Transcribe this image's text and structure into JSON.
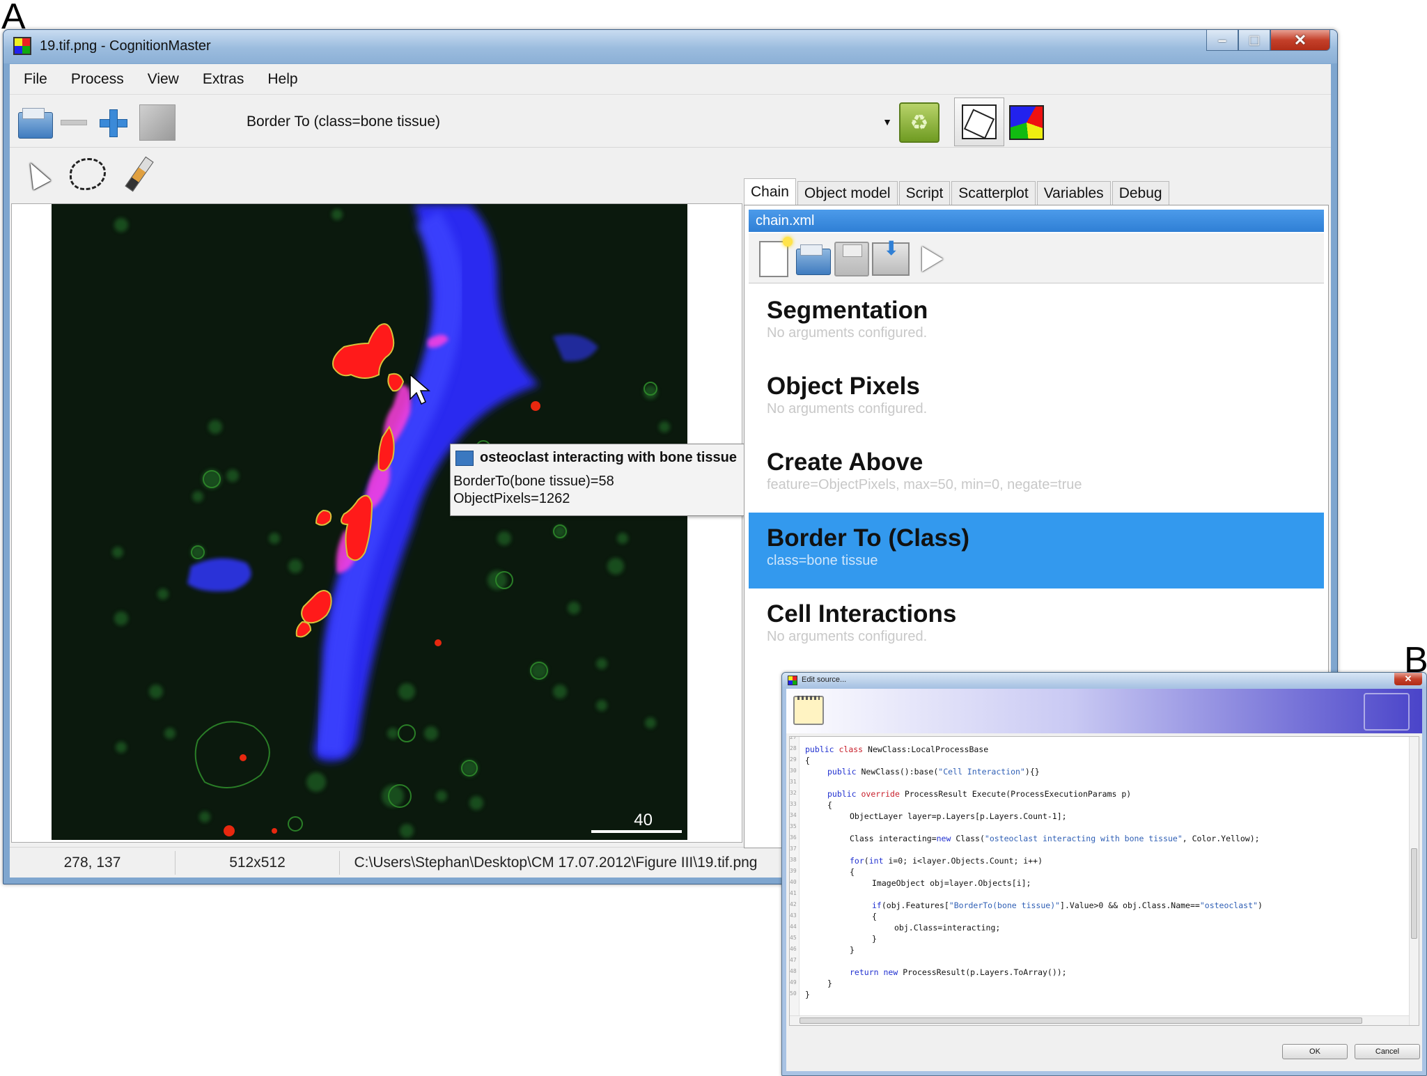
{
  "labels": {
    "panel_a": "A",
    "panel_b": "B"
  },
  "window_a": {
    "title": "19.tif.png - CognitionMaster",
    "menu": [
      "File",
      "Process",
      "View",
      "Extras",
      "Help"
    ],
    "toolbar": {
      "process_combo_value": "Border To (class=bone tissue)",
      "icons": [
        "open-folder-icon",
        "zoom-out-icon",
        "zoom-in-icon",
        "fit-to-window-icon",
        "recycle-bin-icon",
        "segment-outline-icon",
        "segment-colors-icon"
      ]
    },
    "tools": [
      "pointer-icon",
      "lasso-icon",
      "brush-icon"
    ],
    "image": {
      "scale_bar_label": "40",
      "tooltip": {
        "title": "osteoclast interacting with bone tissue",
        "line1": "BorderTo(bone tissue)=58",
        "line2": "ObjectPixels=1262"
      }
    },
    "status": {
      "coordinates": "278, 137",
      "dimensions": "512x512",
      "path": "C:\\Users\\Stephan\\Desktop\\CM 17.07.2012\\Figure III\\19.tif.png"
    },
    "tabs": [
      "Chain",
      "Object model",
      "Script",
      "Scatterplot",
      "Variables",
      "Debug"
    ],
    "active_tab": "Chain",
    "chain": {
      "file": "chain.xml",
      "steps": [
        {
          "name": "Segmentation",
          "args": "No arguments configured."
        },
        {
          "name": "Object Pixels",
          "args": "No arguments configured."
        },
        {
          "name": "Create Above",
          "args": "feature=ObjectPixels, max=50, min=0, negate=true"
        },
        {
          "name": "Border To (Class)",
          "args": "class=bone tissue"
        },
        {
          "name": "Cell Interactions",
          "args": "No arguments configured."
        }
      ],
      "selected_step": "Border To (Class)"
    },
    "colors": {
      "accent": "#3399ee",
      "title_bar": "#9bbcde"
    }
  },
  "window_b": {
    "title": "Edit source...",
    "line_numbers": [
      "27",
      "28",
      "29",
      "30",
      "31",
      "32",
      "33",
      "34",
      "35",
      "36",
      "37",
      "38",
      "39",
      "40",
      "41",
      "42",
      "43",
      "44",
      "45",
      "46",
      "47",
      "48",
      "49",
      "50"
    ],
    "code": {
      "l1_kw1": "public",
      "l1_kw2": "class",
      "l1_rest": "NewClass:LocalProcessBase",
      "l2": "{",
      "l3_kw": "public",
      "l3_rest": "NewClass():base(",
      "l3_str": "\"Cell Interaction\"",
      "l3_end": "){}",
      "l4_kw1": "public",
      "l4_kw2": "override",
      "l4_rest": "ProcessResult Execute(ProcessExecutionParams p)",
      "l5": "{",
      "l6": "ObjectLayer layer=p.Layers[p.Layers.Count-1];",
      "l7_a": "Class interacting=",
      "l7_kw": "new",
      "l7_b": "Class(",
      "l7_str": "\"osteoclast interacting with bone tissue\"",
      "l7_end": ", Color.Yellow);",
      "l8_kw1": "for",
      "l8_a": "(",
      "l8_kw2": "int",
      "l8_b": "i=0; i<layer.Objects.Count; i++)",
      "l9": "{",
      "l10": "ImageObject obj=layer.Objects[i];",
      "l11_kw": "if",
      "l11_a": "(obj.Features[",
      "l11_str": "\"BorderTo(bone tissue)\"",
      "l11_b": "].Value>0 && obj.Class.Name==",
      "l11_str2": "\"osteoclast\"",
      "l11_end": ")",
      "l12": "{",
      "l13": "obj.Class=interacting;",
      "l14": "}",
      "l15": "}",
      "l16_kw1": "return",
      "l16_kw2": "new",
      "l16_rest": "ProcessResult(p.Layers.ToArray());",
      "l17": "}",
      "l18": "}"
    },
    "buttons": {
      "ok": "OK",
      "cancel": "Cancel"
    }
  }
}
